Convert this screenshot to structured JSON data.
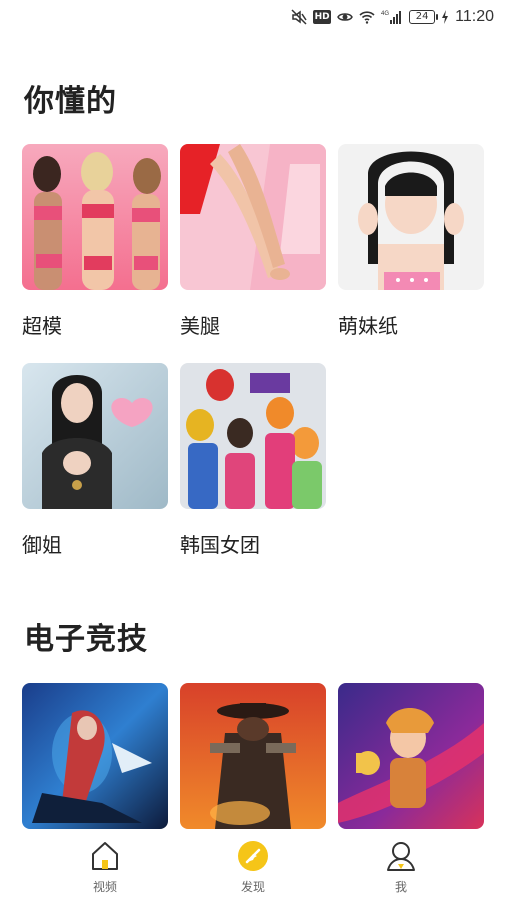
{
  "status_bar": {
    "time": "11:20",
    "battery": "24",
    "network": "4G",
    "hd_badge": "HD",
    "icons": [
      "mute-icon",
      "hd-icon",
      "eye-icon",
      "wifi-icon",
      "signal-icon",
      "battery-icon",
      "charging-icon"
    ]
  },
  "sections": [
    {
      "title": "你懂的",
      "items": [
        {
          "label": "超模",
          "thumb_icon": "supermodel-thumbnail"
        },
        {
          "label": "美腿",
          "thumb_icon": "legs-thumbnail"
        },
        {
          "label": "萌妹纸",
          "thumb_icon": "cute-girl-thumbnail"
        },
        {
          "label": "御姐",
          "thumb_icon": "mature-woman-thumbnail"
        },
        {
          "label": "韩国女团",
          "thumb_icon": "kpop-group-thumbnail"
        }
      ]
    },
    {
      "title": "电子竞技",
      "items": [
        {
          "thumb_icon": "esports-thumbnail-1"
        },
        {
          "thumb_icon": "esports-thumbnail-2"
        },
        {
          "thumb_icon": "esports-thumbnail-3"
        }
      ]
    }
  ],
  "bottom_nav": {
    "items": [
      {
        "label": "视频",
        "icon": "home-icon",
        "active": false
      },
      {
        "label": "发现",
        "icon": "compass-icon",
        "active": true
      },
      {
        "label": "我",
        "icon": "profile-icon",
        "active": false
      }
    ],
    "active_color": "#F5C518",
    "inactive_color": "#333333"
  }
}
